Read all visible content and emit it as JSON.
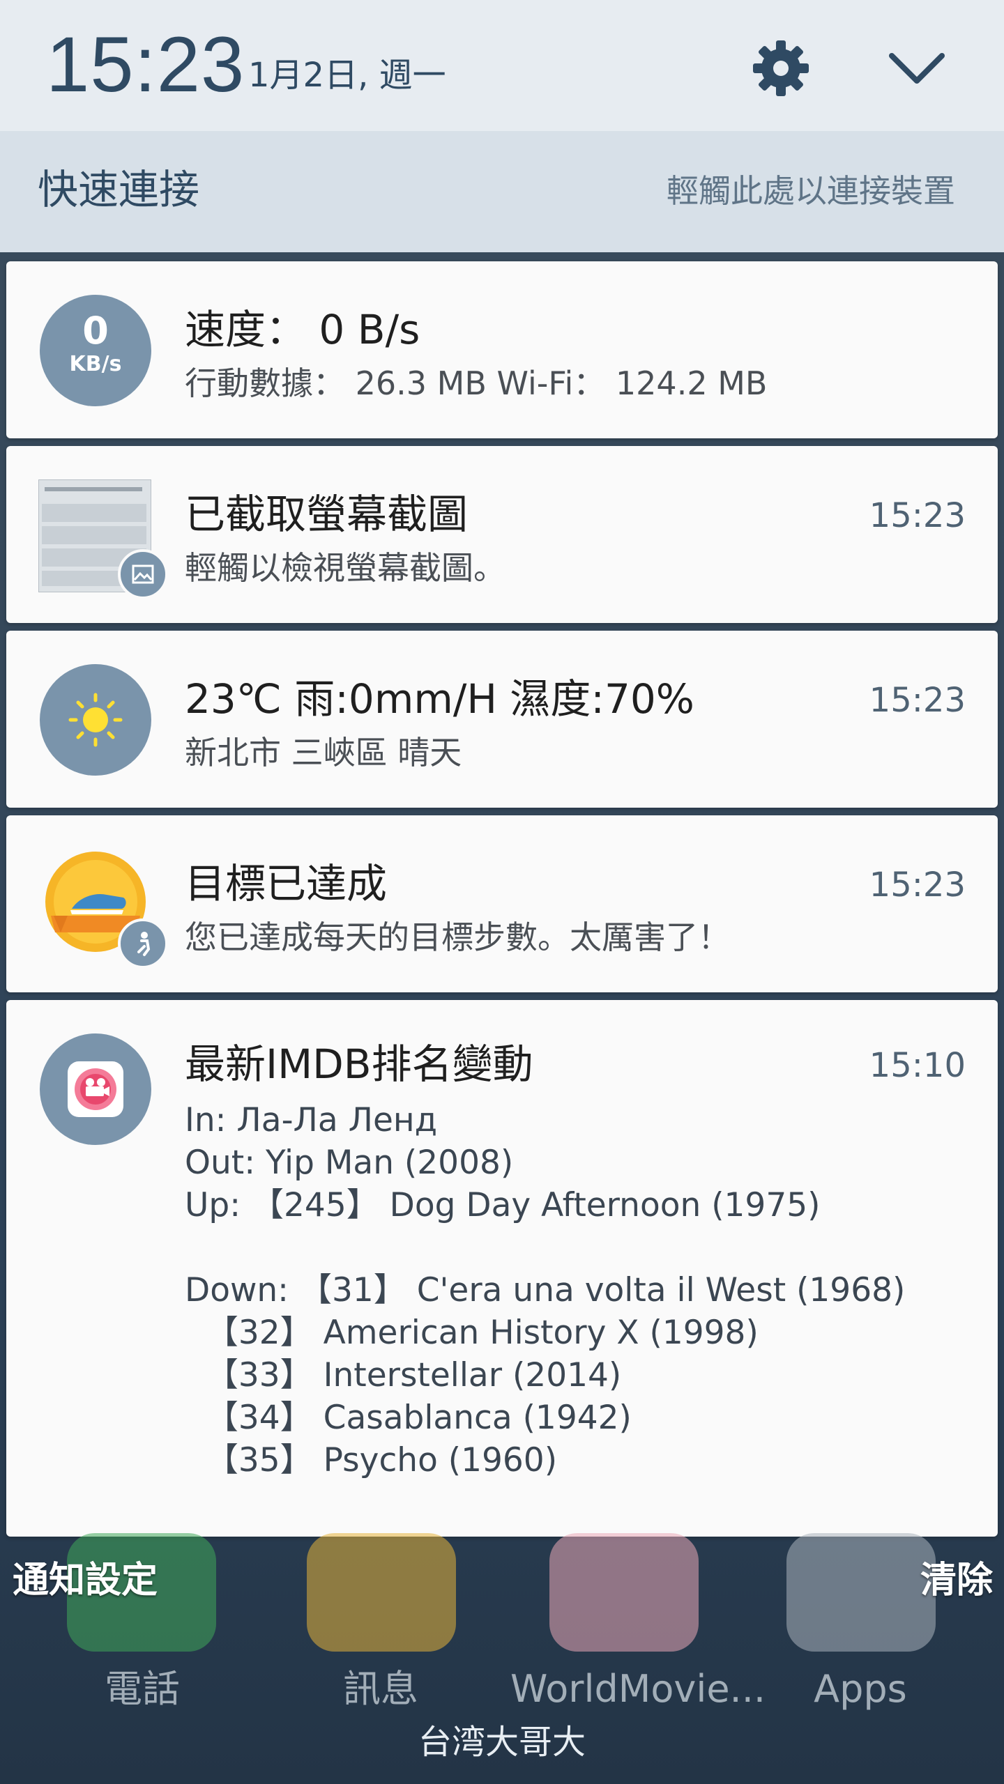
{
  "header": {
    "time": "15:23",
    "date": "1月2日, 週一"
  },
  "quick_connect": {
    "title": "快速連接",
    "hint": "輕觸此處以連接裝置"
  },
  "notifications": {
    "speed": {
      "icon_value": "0",
      "icon_unit": "KB/s",
      "title": "速度： 0 B/s",
      "subtitle": "行動數據： 26.3 MB   Wi-Fi： 124.2 MB"
    },
    "screenshot": {
      "title": "已截取螢幕截圖",
      "subtitle": "輕觸以檢視螢幕截圖。",
      "time": "15:23"
    },
    "weather": {
      "title": "23℃   雨:0mm/H   濕度:70%",
      "subtitle": "新北市 三峽區        晴天",
      "time": "15:23"
    },
    "goal": {
      "title": "目標已達成",
      "subtitle": "您已達成每天的目標步數。太厲害了！",
      "time": "15:23"
    },
    "imdb": {
      "title": "最新IMDB排名變動",
      "time": "15:10",
      "lines": [
        "In: Ла-Ла Ленд",
        "Out: Yip Man (2008)",
        "Up: 【245】 Dog Day Afternoon (1975)",
        "",
        "Down: 【31】 C'era una volta il West (1968)",
        "  【32】 American History X (1998)",
        "  【33】 Interstellar (2014)",
        "  【34】 Casablanca (1942)",
        "  【35】 Psycho (1960)"
      ]
    }
  },
  "footer": {
    "notification_settings": "通知設定",
    "clear": "清除"
  },
  "dock": {
    "phone": "電話",
    "messages": "訊息",
    "worldmovie": "WorldMovie...",
    "apps": "Apps",
    "carrier": "台湾大哥大"
  },
  "colors": {
    "accent": "#2f4a63",
    "icon_circle": "#7a94ab",
    "card": "#fafafa"
  }
}
